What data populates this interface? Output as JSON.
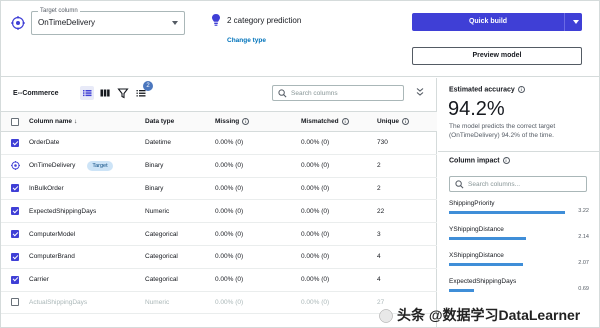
{
  "target": {
    "label": "Target column",
    "value": "OnTimeDelivery"
  },
  "prediction": {
    "text": "2 category prediction",
    "change_link": "Change type"
  },
  "buttons": {
    "quick_build": "Quick build",
    "preview": "Preview model"
  },
  "toolbar": {
    "dataset": "E--Commerce",
    "badge_count": "2",
    "search_placeholder": "Search columns"
  },
  "table": {
    "headers": {
      "name": "Column name",
      "type": "Data type",
      "missing": "Missing",
      "mismatched": "Mismatched",
      "unique": "Unique"
    },
    "rows": [
      {
        "checked": true,
        "name": "OrderDate",
        "type": "Datetime",
        "missing": "0.00% (0)",
        "mismatched": "0.00% (0)",
        "unique": "730"
      },
      {
        "target": true,
        "name": "OnTimeDelivery",
        "tag": "Target",
        "type": "Binary",
        "missing": "0.00% (0)",
        "mismatched": "0.00% (0)",
        "unique": "2"
      },
      {
        "checked": true,
        "name": "InBulkOrder",
        "type": "Binary",
        "missing": "0.00% (0)",
        "mismatched": "0.00% (0)",
        "unique": "2"
      },
      {
        "checked": true,
        "name": "ExpectedShippingDays",
        "type": "Numeric",
        "missing": "0.00% (0)",
        "mismatched": "0.00% (0)",
        "unique": "22"
      },
      {
        "checked": true,
        "name": "ComputerModel",
        "type": "Categorical",
        "missing": "0.00% (0)",
        "mismatched": "0.00% (0)",
        "unique": "3"
      },
      {
        "checked": true,
        "name": "ComputerBrand",
        "type": "Categorical",
        "missing": "0.00% (0)",
        "mismatched": "0.00% (0)",
        "unique": "4"
      },
      {
        "checked": true,
        "name": "Carrier",
        "type": "Categorical",
        "missing": "0.00% (0)",
        "mismatched": "0.00% (0)",
        "unique": "4"
      },
      {
        "checked": false,
        "name": "ActualShippingDays",
        "type": "Numeric",
        "missing": "0.00% (0)",
        "mismatched": "0.00% (0)",
        "unique": "27"
      }
    ]
  },
  "accuracy": {
    "title": "Estimated accuracy",
    "value": "94.2%",
    "description": "The model predicts the correct target (OnTimeDelivery) 94.2% of the time."
  },
  "impact": {
    "title": "Column impact",
    "search_placeholder": "Search columns...",
    "items": [
      {
        "name": "ShippingPriority",
        "value": "3.22"
      },
      {
        "name": "YShippingDistance",
        "value": "2.14"
      },
      {
        "name": "XShippingDistance",
        "value": "2.07"
      },
      {
        "name": "ExpectedShippingDays",
        "value": "0.69"
      }
    ]
  },
  "watermark": "头条 @数据学习DataLearner",
  "colors": {
    "primary": "#3f3fd6",
    "link": "#0073bb",
    "bar": "#3f8ed8"
  }
}
